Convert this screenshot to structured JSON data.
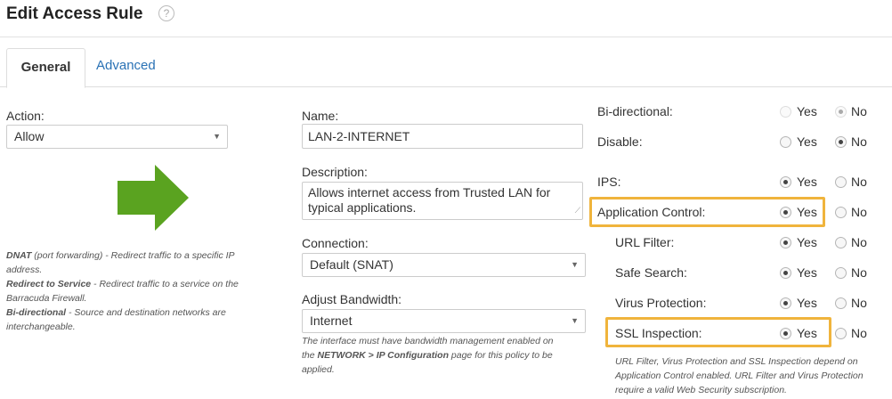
{
  "header": {
    "title": "Edit Access Rule",
    "help_glyph": "?"
  },
  "tabs": {
    "general": "General",
    "advanced": "Advanced"
  },
  "left": {
    "action_label": "Action:",
    "action_value": "Allow",
    "arrow_color": "#5aa320",
    "notes": [
      {
        "term": "DNAT",
        "text": " (port forwarding) - Redirect traffic to a specific IP address."
      },
      {
        "term": "Redirect to Service",
        "text": " - Redirect traffic to a service on the Barracuda Firewall."
      },
      {
        "term": "Bi-directional",
        "text": " - Source and destination networks are interchangeable."
      }
    ]
  },
  "middle": {
    "name_label": "Name:",
    "name_value": "LAN-2-INTERNET",
    "description_label": "Description:",
    "description_value": "Allows internet access from Trusted LAN for typical applications.",
    "connection_label": "Connection:",
    "connection_value": "Default (SNAT)",
    "bandwidth_label": "Adjust Bandwidth:",
    "bandwidth_value": "Internet",
    "bandwidth_note_pre": "The interface must have bandwidth management enabled on the ",
    "bandwidth_note_bold": "NETWORK > IP Configuration",
    "bandwidth_note_post": " page for this policy to be applied."
  },
  "right": {
    "yes": "Yes",
    "no": "No",
    "options": [
      {
        "label": "Bi-directional:",
        "value": "No",
        "disabled": true
      },
      {
        "label": "Disable:",
        "value": "No"
      },
      {
        "label": "IPS:",
        "value": "Yes"
      },
      {
        "label": "Application Control:",
        "value": "Yes",
        "highlighted": true
      },
      {
        "label": "URL Filter:",
        "value": "Yes",
        "indented": true
      },
      {
        "label": "Safe Search:",
        "value": "Yes",
        "indented": true
      },
      {
        "label": "Virus Protection:",
        "value": "Yes",
        "indented": true
      },
      {
        "label": "SSL Inspection:",
        "value": "Yes",
        "indented": true,
        "highlighted": true
      }
    ],
    "footnote": "URL Filter, Virus Protection and SSL Inspection depend on Application Control enabled. URL Filter and Virus Protection require a valid Web Security subscription.",
    "highlight_color": "#f0b43c"
  }
}
